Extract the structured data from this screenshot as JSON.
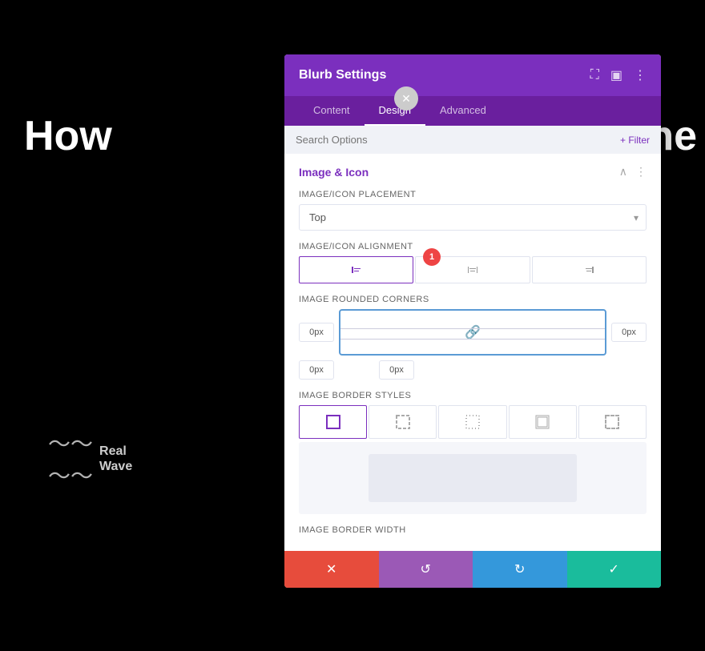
{
  "background": {
    "text_left": "How",
    "text_right": "the"
  },
  "logo": {
    "name": "Real\nWave"
  },
  "panel": {
    "title": "Blurb Settings",
    "tabs": [
      {
        "label": "Content",
        "active": false
      },
      {
        "label": "Design",
        "active": true
      },
      {
        "label": "Advanced",
        "active": false
      }
    ],
    "search_placeholder": "Search Options",
    "filter_label": "+ Filter",
    "section": {
      "title": "Image & Icon",
      "placement_label": "Image/Icon Placement",
      "placement_value": "Top",
      "alignment_label": "Image/Icon Alignment",
      "rounded_corners_label": "Image Rounded Corners",
      "corner_tl": "0px",
      "corner_tr": "0px",
      "corner_bl": "0px",
      "corner_br": "0px",
      "badge_number": "1",
      "border_styles_label": "Image Border Styles",
      "border_width_label": "Image Border Width"
    },
    "actions": {
      "cancel": "✕",
      "undo": "↺",
      "redo": "↻",
      "save": "✓"
    }
  }
}
